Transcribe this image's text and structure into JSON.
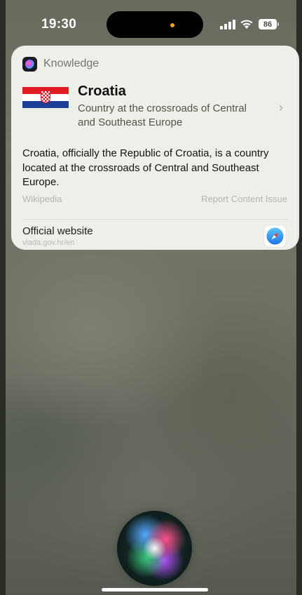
{
  "status_bar": {
    "time": "19:30",
    "battery_level": "86",
    "privacy_indicator_color": "#f59e0b"
  },
  "card": {
    "header_label": "Knowledge",
    "header_icon": "siri-knowledge-icon",
    "title": "Croatia",
    "subtitle": "Country at the crossroads of Central and Southeast Europe",
    "description": "Croatia, officially the Republic of Croatia, is a country located at the crossroads of Central and Southeast Europe.",
    "source": "Wikipedia",
    "report_link": "Report Content Issue",
    "website": {
      "title": "Official website",
      "url": "vlada.gov.hr/en",
      "icon": "safari-icon"
    },
    "flag_colors": [
      "#e21c24",
      "#ffffff",
      "#1d3f95"
    ]
  },
  "siri": {
    "icon": "siri-orb"
  }
}
